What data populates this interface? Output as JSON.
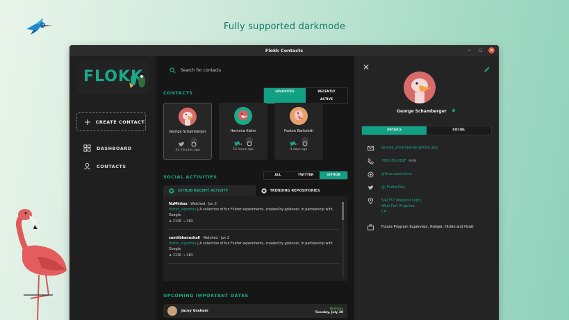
{
  "headline": "Fully supported darkmode",
  "window": {
    "title": "Flokk Contacts",
    "controls": {
      "minimize": "–",
      "maximize": "□",
      "close": "×"
    }
  },
  "sidebar": {
    "logo": "FLOKK",
    "create_label": "CREATE CONTACT",
    "nav": [
      {
        "label": "DASHBOARD",
        "icon": "dashboard-icon"
      },
      {
        "label": "CONTACTS",
        "icon": "person-icon"
      }
    ]
  },
  "search": {
    "placeholder": "Search for contacts"
  },
  "contacts": {
    "title": "CONTACTS",
    "tabs": [
      {
        "label": "FAVORITES",
        "active": true
      },
      {
        "label": "RECENTLY ACTIVE",
        "active": false
      }
    ],
    "cards": [
      {
        "name": "George Schamberger",
        "when": "33 minutes ago",
        "badge_tw": "",
        "badge_gh": ""
      },
      {
        "name": "Hermina Kiehn",
        "when": "15 hours ago",
        "badge_tw": "9+",
        "badge_gh": ""
      },
      {
        "name": "Paxton Bartoletti",
        "when": "4 days ago",
        "badge_tw": "9+",
        "badge_gh": ""
      }
    ]
  },
  "social": {
    "title": "SOCIAL ACTIVITIES",
    "tabs": [
      {
        "label": "ALL",
        "active": false
      },
      {
        "label": "TWITTER",
        "active": false
      },
      {
        "label": "GITHUB",
        "active": true
      }
    ],
    "panel_tabs": [
      {
        "label": "GITHUB RECENT ACTIVITY",
        "active": true
      },
      {
        "label": "TRENDING REPOSITORIES",
        "active": false
      }
    ],
    "items": [
      {
        "user": "NuMinhaz",
        "action": "· Watched · Jun 2",
        "repo": "flutter_vignettes",
        "desc": " | A collection of fun Flutter experiments, created by gskinner, in partnership with Google.",
        "stars": "★ 2136",
        "forks": "⑂ 483"
      },
      {
        "user": "sumitbhanushali",
        "action": "· Watched · Jun 2",
        "repo": "flutter_vignettes",
        "desc": " | A collection of fun Flutter experiments, created by gskinner, in partnership with Google.",
        "stars": "★ 2136",
        "forks": "⑂ 483"
      }
    ]
  },
  "dates": {
    "title": "UPCOMING IMPORTANT DATES",
    "rows": [
      {
        "name": "Jacey Graham",
        "event": "Birthday",
        "date": "Tuesday, July 30"
      }
    ]
  },
  "details": {
    "name": "George Schamberger",
    "tabs": [
      {
        "label": "DETAILS",
        "active": true
      },
      {
        "label": "SOCIAL",
        "active": false
      }
    ],
    "email": "george_schamberger@flokk.app",
    "phone": "780-555-0197",
    "phone_label": "MAIN",
    "github": "github.com/vlene",
    "twitter": "@_FlutterDev",
    "address": [
      "542757 Wiegand Light,",
      "West Port Angelina,",
      "CA"
    ],
    "job": "Future Program Supervisor, Kreiger, Hickle and Hyatt"
  },
  "colors": {
    "accent": "#11a084",
    "birthday": "#7fd14b",
    "headline": "#117a64"
  }
}
